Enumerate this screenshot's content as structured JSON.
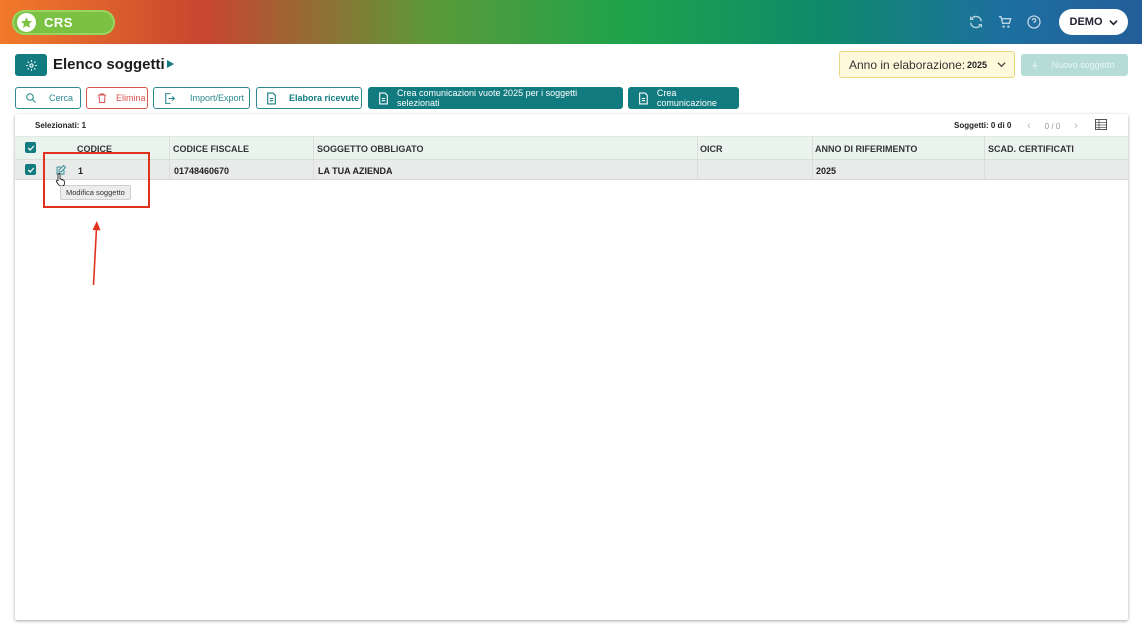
{
  "header": {
    "app_name": "CRS",
    "icons": [
      "refresh-icon",
      "cart-icon",
      "help-icon"
    ],
    "user_label": "DEMO",
    "gradient_colors": [
      "#f07a2a",
      "#1ea34b",
      "#245e9a"
    ]
  },
  "title_bar": {
    "title": "Elenco soggetti",
    "year_label": "Anno in elaborazione:",
    "year_value": "2025",
    "new_button": "Nuovo soggetto"
  },
  "toolbar": {
    "search": "Cerca",
    "delete": "Elimina",
    "import_export": "Import/Export",
    "process": "Elabora ricevute",
    "create_empty": "Crea comunicazioni vuote 2025 per i soggetti selezionati",
    "create": "Crea comunicazione"
  },
  "table": {
    "selected": "Selezionati: 1",
    "count": "Soggetti: 0 di 0",
    "pager": "0 / 0",
    "columns": [
      "CODICE",
      "CODICE FISCALE",
      "SOGGETTO OBBLIGATO",
      "OICR",
      "ANNO DI RIFERIMENTO",
      "SCAD. CERTIFICATI"
    ],
    "rows": [
      {
        "codice": "1",
        "codice_fiscale": "01748460670",
        "soggetto": "LA TUA AZIENDA",
        "oicr": "",
        "anno": "2025",
        "scad": ""
      }
    ],
    "tooltip": "Modifica soggetto"
  },
  "accent_color": "#127b80",
  "annotation_color": "#e0321e"
}
